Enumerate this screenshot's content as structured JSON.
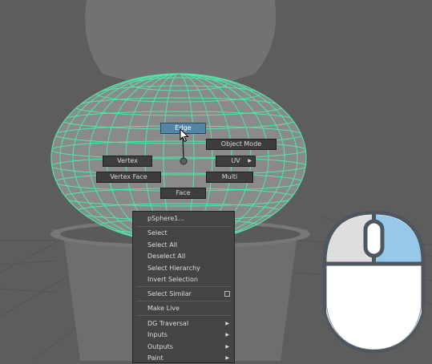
{
  "marking_menu": {
    "edge": "Edge",
    "object_mode": "Object Mode",
    "vertex": "Vertex",
    "uv": "UV",
    "vertex_face": "Vertex Face",
    "multi": "Multi",
    "face": "Face"
  },
  "context_menu": {
    "header": "pSphere1...",
    "items": {
      "select": "Select",
      "select_all": "Select All",
      "deselect_all": "Deselect All",
      "select_hierarchy": "Select Hierarchy",
      "invert_selection": "Invert Selection",
      "select_similar": "Select Similar",
      "make_live": "Make Live",
      "dg_traversal": "DG Traversal",
      "inputs": "Inputs",
      "outputs": "Outputs",
      "paint": "Paint"
    },
    "submenu_arrow": "▶"
  },
  "icons": {
    "cursor": "arrow-pointer-icon",
    "mouse": "mouse-right-button-icon"
  },
  "colors": {
    "viewport_bg": "#5d5d5d",
    "wireframe": "#4de8a8",
    "highlight": "#5285a6",
    "mouse_right_button": "#96c8ea"
  }
}
